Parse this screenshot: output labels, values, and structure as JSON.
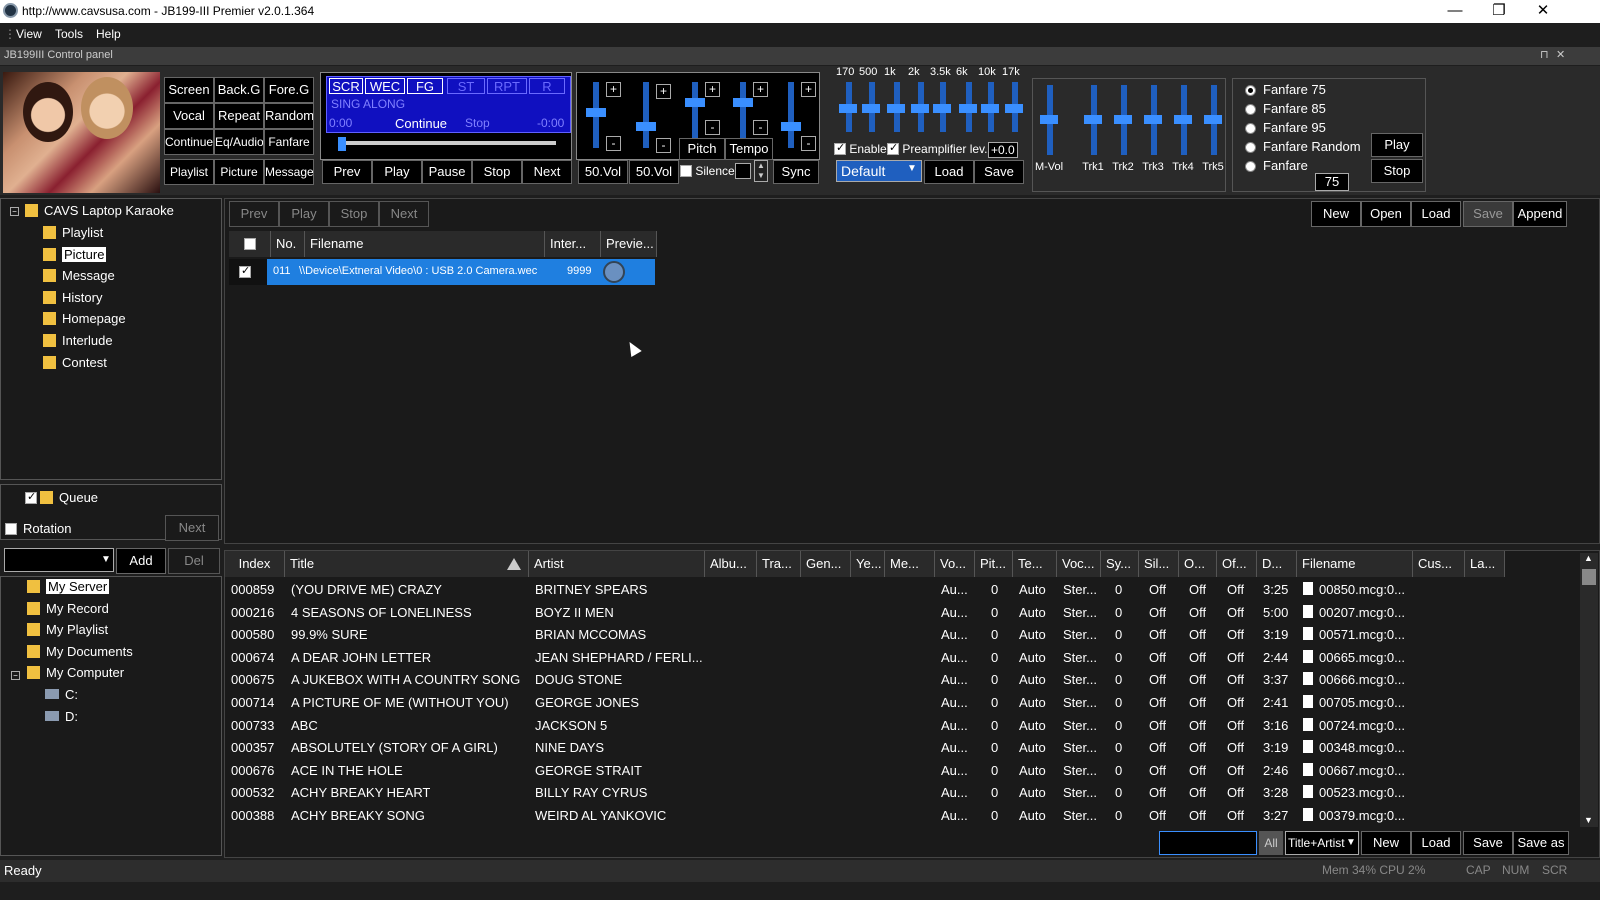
{
  "window": {
    "title": "http://www.cavsusa.com - JB199-III Premier v2.0.1.364",
    "minimize": "—",
    "maximize": "❐",
    "close": "✕"
  },
  "menu": [
    "View",
    "Tools",
    "Help"
  ],
  "control_panel": {
    "title": "JB199III Control panel",
    "pin": "⊓",
    "close": "✕",
    "grid": [
      [
        "Screen",
        "Back.G",
        "Fore.G"
      ],
      [
        "Vocal",
        "Repeat",
        "Random"
      ],
      [
        "Continue",
        "Eq/Audio",
        "Fanfare"
      ],
      [
        "Playlist",
        "Picture",
        "Message"
      ]
    ],
    "tags": [
      "SCR",
      "WEC",
      "FG",
      "ST",
      "RPT",
      "R"
    ],
    "singalong": "SING ALONG",
    "time_start": "0:00",
    "continue": "Continue",
    "stop_label": "Stop",
    "time_end": "-0:00",
    "transport": [
      "Prev",
      "Play",
      "Pause",
      "Stop",
      "Next"
    ],
    "vol1": "50.Vol",
    "vol2": "50.Vol",
    "pitch": "Pitch",
    "tempo": "Tempo",
    "silence": "Silence",
    "sync": "Sync",
    "plus": "+",
    "minus": "-",
    "eq_bands": [
      "170",
      "500",
      "1k",
      "2k",
      "3.5k",
      "6k",
      "10k",
      "17k"
    ],
    "enable": "Enable",
    "preamp": "Preamplifier lev...",
    "preamp_val": "+0.0",
    "preset": "Default",
    "load": "Load",
    "save": "Save",
    "mixer": [
      "M-Vol",
      "Trk1",
      "Trk2",
      "Trk3",
      "Trk4",
      "Trk5"
    ],
    "fanfare": [
      "Fanfare 75",
      "Fanfare 85",
      "Fanfare 95",
      "Fanfare Random",
      "Fanfare"
    ],
    "fanfare_val": "75",
    "fan_play": "Play",
    "fan_stop": "Stop"
  },
  "tree": {
    "root": "CAVS Laptop Karaoke",
    "items": [
      "Playlist",
      "Picture",
      "Message",
      "History",
      "Homepage",
      "Interlude",
      "Contest"
    ],
    "selected": "Picture"
  },
  "queue": {
    "label": "Queue",
    "rotation": "Rotation",
    "next": "Next",
    "add": "Add",
    "del": "Del"
  },
  "library": {
    "items": [
      "My Server",
      "My Record",
      "My Playlist",
      "My Documents",
      "My Computer"
    ],
    "drives": [
      "C:",
      "D:"
    ]
  },
  "playlist": {
    "toolbar": [
      "Prev",
      "Play",
      "Stop",
      "Next"
    ],
    "right_toolbar": [
      "New",
      "Open",
      "Load",
      "Save",
      "Append"
    ],
    "headers": [
      "No.",
      "Filename",
      "Inter...",
      "Previe..."
    ],
    "row": {
      "no": "011",
      "filename": "\\\\Device\\Extneral Video\\0 : USB 2.0 Camera.wec",
      "inter": "9999"
    }
  },
  "songs": {
    "headers": [
      "Index",
      "Title",
      "Artist",
      "Albu...",
      "Tra...",
      "Gen...",
      "Ye...",
      "Me...",
      "Vo...",
      "Pit...",
      "Te...",
      "Voc...",
      "Sy...",
      "Sil...",
      "O...",
      "Of...",
      "D...",
      "Filename",
      "Cus...",
      "La..."
    ],
    "rows": [
      [
        "000859",
        "(YOU DRIVE ME) CRAZY",
        "BRITNEY SPEARS",
        "3:25",
        "00850.mcg:0..."
      ],
      [
        "000216",
        "4 SEASONS OF LONELINESS",
        "BOYZ II MEN",
        "5:00",
        "00207.mcg:0..."
      ],
      [
        "000580",
        "99.9% SURE",
        "BRIAN MCCOMAS",
        "3:19",
        "00571.mcg:0..."
      ],
      [
        "000674",
        "A DEAR JOHN LETTER",
        "JEAN SHEPHARD / FERLI...",
        "2:44",
        "00665.mcg:0..."
      ],
      [
        "000675",
        "A JUKEBOX WITH A COUNTRY SONG",
        "DOUG STONE",
        "3:37",
        "00666.mcg:0..."
      ],
      [
        "000714",
        "A PICTURE OF ME (WITHOUT YOU)",
        "GEORGE JONES",
        "2:41",
        "00705.mcg:0..."
      ],
      [
        "000733",
        "ABC",
        "JACKSON 5",
        "3:16",
        "00724.mcg:0..."
      ],
      [
        "000357",
        "ABSOLUTELY (STORY OF A GIRL)",
        "NINE DAYS",
        "3:19",
        "00348.mcg:0..."
      ],
      [
        "000676",
        "ACE IN THE HOLE",
        "GEORGE STRAIT",
        "2:46",
        "00667.mcg:0..."
      ],
      [
        "000532",
        "ACHY BREAKY HEART",
        "BILLY RAY CYRUS",
        "3:28",
        "00523.mcg:0..."
      ],
      [
        "000388",
        "ACHY BREAKY SONG",
        "WEIRD AL YANKOVIC",
        "3:27",
        "00379.mcg:0..."
      ]
    ],
    "common": {
      "vo": "Au...",
      "pit": "0",
      "te": "Auto",
      "voc": "Ster...",
      "sy": "0",
      "sil": "Off",
      "o": "Off",
      "of": "Off"
    },
    "footer": [
      "All",
      "Title+Artist",
      "New",
      "Load",
      "Save",
      "Save as"
    ]
  },
  "status": {
    "ready": "Ready",
    "mem": "Mem 34% CPU  2%",
    "cap": "CAP",
    "num": "NUM",
    "scr": "SCR"
  }
}
